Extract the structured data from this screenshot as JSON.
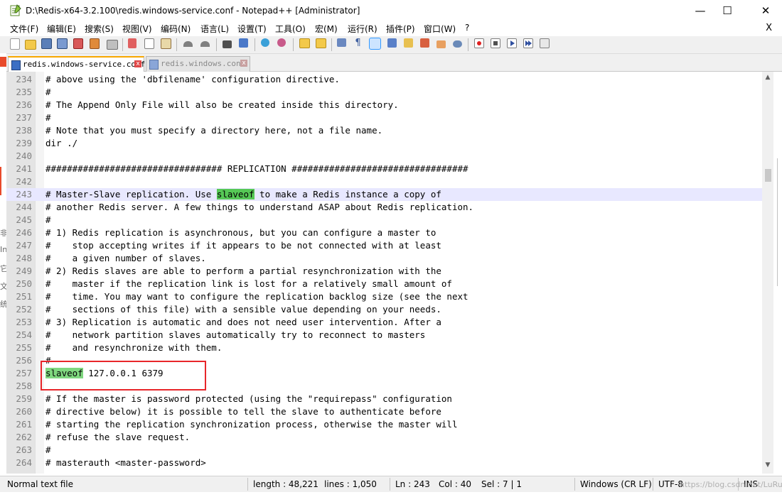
{
  "window": {
    "title": "D:\\Redis-x64-3.2.100\\redis.windows-service.conf - Notepad++ [Administrator]",
    "minimize": "—",
    "maximize": "☐",
    "close": "✕"
  },
  "menu": {
    "items": [
      "文件(F)",
      "编辑(E)",
      "搜索(S)",
      "视图(V)",
      "编码(N)",
      "语言(L)",
      "设置(T)",
      "工具(O)",
      "宏(M)",
      "运行(R)",
      "插件(P)",
      "窗口(W)",
      "?"
    ],
    "close_doc": "X"
  },
  "tabs": [
    {
      "label": "redis.windows-service.conf",
      "active": true
    },
    {
      "label": "redis.windows.conf",
      "active": false
    }
  ],
  "editor": {
    "current_line": 243,
    "lines": [
      {
        "n": "234",
        "text": "# above using the 'dbfilename' configuration directive."
      },
      {
        "n": "235",
        "text": "#"
      },
      {
        "n": "236",
        "text": "# The Append Only File will also be created inside this directory."
      },
      {
        "n": "237",
        "text": "#"
      },
      {
        "n": "238",
        "text": "# Note that you must specify a directory here, not a file name."
      },
      {
        "n": "239",
        "text": "dir ./"
      },
      {
        "n": "240",
        "text": ""
      },
      {
        "n": "241",
        "text": "################################# REPLICATION #################################"
      },
      {
        "n": "242",
        "text": ""
      },
      {
        "n": "243",
        "pre": "# Master-Slave replication. Use ",
        "hl": "slaveof",
        "post": " to make a Redis instance a copy of"
      },
      {
        "n": "244",
        "text": "# another Redis server. A few things to understand ASAP about Redis replication."
      },
      {
        "n": "245",
        "text": "#"
      },
      {
        "n": "246",
        "text": "# 1) Redis replication is asynchronous, but you can configure a master to"
      },
      {
        "n": "247",
        "text": "#    stop accepting writes if it appears to be not connected with at least"
      },
      {
        "n": "248",
        "text": "#    a given number of slaves."
      },
      {
        "n": "249",
        "text": "# 2) Redis slaves are able to perform a partial resynchronization with the"
      },
      {
        "n": "250",
        "text": "#    master if the replication link is lost for a relatively small amount of"
      },
      {
        "n": "251",
        "text": "#    time. You may want to configure the replication backlog size (see the next"
      },
      {
        "n": "252",
        "text": "#    sections of this file) with a sensible value depending on your needs."
      },
      {
        "n": "253",
        "text": "# 3) Replication is automatic and does not need user intervention. After a"
      },
      {
        "n": "254",
        "text": "#    network partition slaves automatically try to reconnect to masters"
      },
      {
        "n": "255",
        "text": "#    and resynchronize with them."
      },
      {
        "n": "256",
        "text": "#"
      },
      {
        "n": "257",
        "pre": "",
        "hl": "slaveof",
        "post": " 127.0.0.1 6379"
      },
      {
        "n": "258",
        "text": ""
      },
      {
        "n": "259",
        "text": "# If the master is password protected (using the \"requirepass\" configuration"
      },
      {
        "n": "260",
        "text": "# directive below) it is possible to tell the slave to authenticate before"
      },
      {
        "n": "261",
        "text": "# starting the replication synchronization process, otherwise the master will"
      },
      {
        "n": "262",
        "text": "# refuse the slave request."
      },
      {
        "n": "263",
        "text": "#"
      },
      {
        "n": "264",
        "text": "# masterauth <master-password>"
      }
    ]
  },
  "status": {
    "filetype": "Normal text file",
    "length": "length : 48,221",
    "lines": "lines : 1,050",
    "ln": "Ln : 243",
    "col": "Col : 40",
    "sel": "Sel : 7 | 1",
    "eol": "Windows (CR LF)",
    "encoding": "UTF-8",
    "mode": "INS",
    "watermark": "https://blog.csdn.net/LuRuiTag"
  },
  "colors": {
    "highlight": "#7fd77f",
    "current_line": "#e8e8ff",
    "annotation_box": "#e8262a"
  }
}
